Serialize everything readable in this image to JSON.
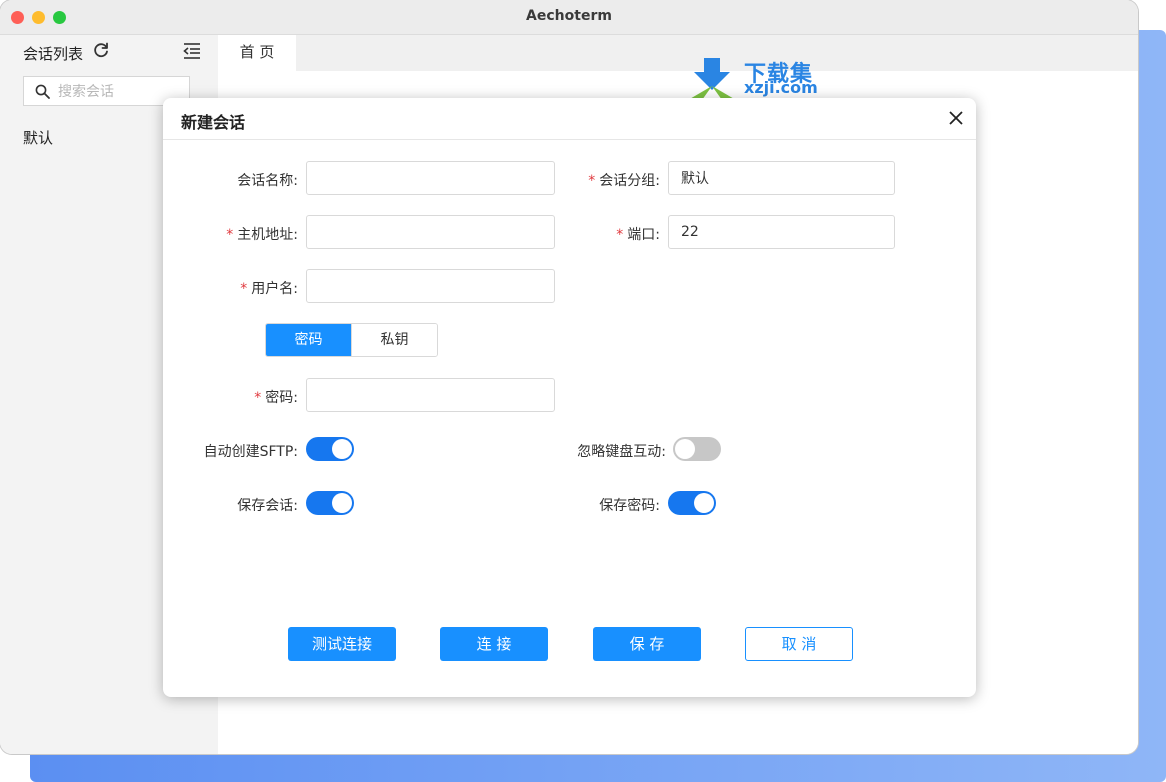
{
  "window": {
    "title": "Aechoterm"
  },
  "sidebar": {
    "title": "会话列表",
    "search_placeholder": "搜索会话",
    "groups": [
      "默认"
    ]
  },
  "tabs": [
    {
      "label": "首 页"
    }
  ],
  "watermark": {
    "line1": "下载集",
    "line2": "xzji.com"
  },
  "dialog": {
    "title": "新建会话",
    "fields": {
      "session_name": {
        "label": "会话名称",
        "value": "",
        "required": false
      },
      "session_group": {
        "label": "会话分组",
        "value": "默认",
        "required": true
      },
      "host": {
        "label": "主机地址",
        "value": "",
        "required": true
      },
      "port": {
        "label": "端口",
        "value": "22",
        "required": true
      },
      "username": {
        "label": "用户名",
        "value": "",
        "required": true
      },
      "password": {
        "label": "密码",
        "value": "",
        "required": true
      }
    },
    "auth_tabs": {
      "password": "密码",
      "private_key": "私钥",
      "selected": "密码"
    },
    "toggles": {
      "auto_sftp": {
        "label": "自动创建SFTP",
        "on": true
      },
      "ignore_keyboard": {
        "label": "忽略键盘互动",
        "on": false
      },
      "save_session": {
        "label": "保存会话",
        "on": true
      },
      "save_password": {
        "label": "保存密码",
        "on": true
      }
    },
    "buttons": {
      "test": "测试连接",
      "connect": "连 接",
      "save": "保 存",
      "cancel": "取 消"
    },
    "colon": ":"
  },
  "colors": {
    "primary": "#1890ff",
    "required": "#e0393e",
    "switch_on": "#1677ef",
    "switch_off": "#c7c7c7"
  }
}
